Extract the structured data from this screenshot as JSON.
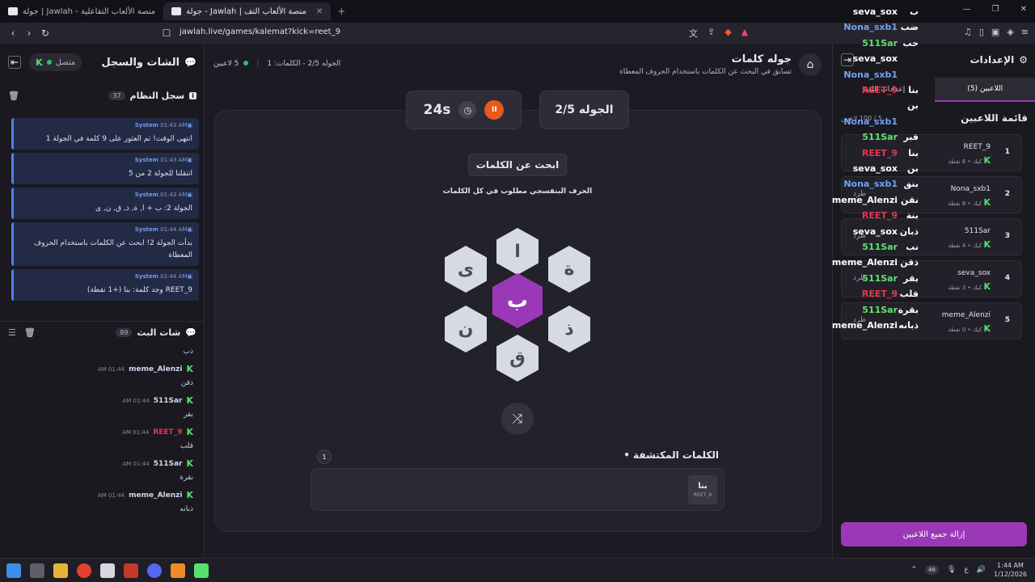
{
  "browser": {
    "tabs": [
      {
        "label": "جولة | Jawlah - منصة الألعاب التفاعلية",
        "active": false
      },
      {
        "label": "جولة - Jawlah | منصة الألعاب التف",
        "active": true
      }
    ],
    "url": "jawlah.live/games/kalemat?kick=reet_9"
  },
  "left": {
    "title": "الشات والسجل",
    "status": "متصل",
    "system_log": {
      "title": "سجل النظام",
      "count": "37"
    },
    "system_messages": [
      {
        "name": "System",
        "time": "01:43 AM",
        "text": "انتهى الوقت! تم العثور على 9 كلمة في الجولة 1"
      },
      {
        "name": "System",
        "time": "01:43 AM",
        "text": "انتقلنا للجولة 2 من 5"
      },
      {
        "name": "System",
        "time": "01:43 AM",
        "text": "الجولة 2: ب + ا, ة, ذ, ق, ن, ى"
      },
      {
        "name": "System",
        "time": "01:44 AM",
        "text": "بدأت الجولة 2! ابحث عن الكلمات باستخدام الحروف المعطاة"
      },
      {
        "name": "System",
        "time": "01:44 AM",
        "text": "REET_9 وجد كلمة: بنا (+1 نقطة)"
      }
    ],
    "stream_chat": {
      "title": "شات البث",
      "count": "89"
    },
    "chat_messages": [
      {
        "user": "",
        "time": "",
        "text": "ذب",
        "color": "#cfd6ea"
      },
      {
        "user": "meme_Alenzi",
        "time": "01:44 AM",
        "text": "ذقن",
        "color": "#cfd6ea"
      },
      {
        "user": "511Sar",
        "time": "01:44 AM",
        "text": "بقر",
        "color": "#cfd6ea"
      },
      {
        "user": "REET_9",
        "time": "01:44 AM",
        "text": "قلب",
        "color": "#e8364e"
      },
      {
        "user": "511Sar",
        "time": "01:44 AM",
        "text": "بقرة",
        "color": "#cfd6ea"
      },
      {
        "user": "meme_Alenzi",
        "time": "01:44 AM",
        "text": "ذبانه",
        "color": "#cfd6ea"
      }
    ]
  },
  "center": {
    "title": "جوله كلمات",
    "subtitle": "تسابق في البحث عن الكلمات باستخدام الحروف المعطاة",
    "players_count": "5 لاعبين",
    "round_words": "الجوله 2/5 - الكلمات: 1",
    "timer": "24s",
    "round_label": "الجوله 2/5",
    "search_label": "ابحث عن الكلمات",
    "hint": "الحرف البنفسجي مطلوب في كل الكلمات",
    "letters": {
      "center": "ب",
      "top": "ا",
      "top_right": "ة",
      "bottom_right": "ذ",
      "bottom": "ق",
      "bottom_left": "ن",
      "top_left": "ى"
    },
    "found_title": "الكلمات المكتشفة",
    "found_count": "1",
    "found_words": [
      {
        "word": "بنا",
        "by": "REET_9"
      }
    ]
  },
  "right": {
    "settings_title": "الإعدادات",
    "tab_players": "اللاعبين (5)",
    "tab_settings": "إعدادات اللعبة",
    "list_title": "قائمة اللاعبين",
    "list_count": "5 / 100 لاعبين",
    "players": [
      {
        "rank": "1",
        "name": "REET_9",
        "meta": "كيك • 6 نقطة",
        "kick": ""
      },
      {
        "rank": "2",
        "name": "Nona_sxb1",
        "meta": "كيك • 6 نقطة",
        "kick": "طرد"
      },
      {
        "rank": "3",
        "name": "511Sar",
        "meta": "كيك • 4 نقطة",
        "kick": "طرد"
      },
      {
        "rank": "4",
        "name": "seva_sox",
        "meta": "كيك • 3 نقطة",
        "kick": "طرد"
      },
      {
        "rank": "5",
        "name": "meme_Alenzi",
        "meta": "كيك • 0 نقطة",
        "kick": "طرد"
      }
    ],
    "remove_all": "إزالة جميع اللاعبين"
  },
  "overlay": [
    {
      "name": "seva_sox",
      "word": "ب",
      "color": "#ffffff"
    },
    {
      "name": "Nona_sxb1",
      "word": "ضب",
      "color": "#6fa3f5"
    },
    {
      "name": "511Sar",
      "word": "حب",
      "color": "#5de36a"
    },
    {
      "name": "seva_sox",
      "word": "",
      "color": "#ffffff"
    },
    {
      "name": "Nona_sxb1",
      "word": "",
      "color": "#6fa3f5"
    },
    {
      "name": "REET_9",
      "word": "بنا",
      "color": "#e8364e"
    },
    {
      "name": "",
      "word": "بن",
      "color": "#ffffff"
    },
    {
      "name": "Nona_sxb1",
      "word": "",
      "color": "#6fa3f5"
    },
    {
      "name": "511Sar",
      "word": "قبر",
      "color": "#5de36a"
    },
    {
      "name": "REET_9",
      "word": "بنا",
      "color": "#e8364e"
    },
    {
      "name": "seva_sox",
      "word": "بن",
      "color": "#ffffff"
    },
    {
      "name": "Nona_sxb1",
      "word": "بنق",
      "color": "#6fa3f5"
    },
    {
      "name": "meme_Alenzi",
      "word": "نقن",
      "color": "#ffffff"
    },
    {
      "name": "REET_9",
      "word": "بنة",
      "color": "#e8364e"
    },
    {
      "name": "seva_sox",
      "word": "ذبان",
      "color": "#ffffff"
    },
    {
      "name": "511Sar",
      "word": "نب",
      "color": "#5de36a"
    },
    {
      "name": "meme_Alenzi",
      "word": "ذقن",
      "color": "#ffffff"
    },
    {
      "name": "511Sar",
      "word": "بقر",
      "color": "#5de36a"
    },
    {
      "name": "REET_9",
      "word": "قلب",
      "color": "#e8364e"
    },
    {
      "name": "511Sar",
      "word": "بقرة",
      "color": "#5de36a"
    },
    {
      "name": "meme_Alenzi",
      "word": "ذبانه",
      "color": "#ffffff"
    }
  ],
  "taskbar": {
    "battery": "46",
    "lang": "ع",
    "time": "1:44 AM",
    "date": "1/12/2026"
  }
}
